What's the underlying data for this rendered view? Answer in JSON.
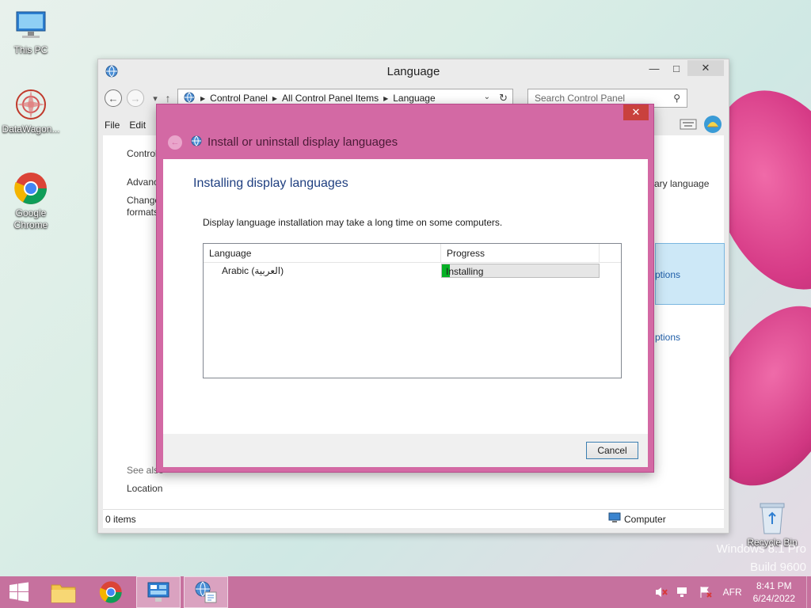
{
  "desktop": {
    "icons": [
      {
        "label": "This PC"
      },
      {
        "label": "DataWagon..."
      },
      {
        "label": "Google Chrome"
      },
      {
        "label": "Recycle Bin"
      }
    ],
    "watermark": {
      "line1": "Windows 8.1 Pro",
      "line2": "Build 9600"
    }
  },
  "main_window": {
    "title": "Language",
    "breadcrumbs": [
      "Control Panel",
      "All Control Panel Items",
      "Language"
    ],
    "search_placeholder": "Search Control Panel",
    "menu": [
      "File",
      "Edit"
    ],
    "partial_texts": {
      "control": "Control",
      "advanced": "Advanc",
      "change": "Change",
      "formats": "formats",
      "primary_language": "ary language",
      "options1": "ptions",
      "options2": "ptions",
      "see_also": "See also",
      "location": "Location"
    },
    "status_left": "0 items",
    "status_right": "Computer"
  },
  "dialog": {
    "title": "Install or uninstall display languages",
    "heading": "Installing display languages",
    "description": "Display language installation may take a long time on some computers.",
    "columns": [
      "Language",
      "Progress"
    ],
    "rows": [
      {
        "language": "Arabic (العربية)",
        "status": "Installing",
        "progress": 0.05
      }
    ],
    "cancel_label": "Cancel"
  },
  "taskbar": {
    "language_indicator": "AFR",
    "time": "8:41 PM",
    "date": "6/24/2022"
  }
}
